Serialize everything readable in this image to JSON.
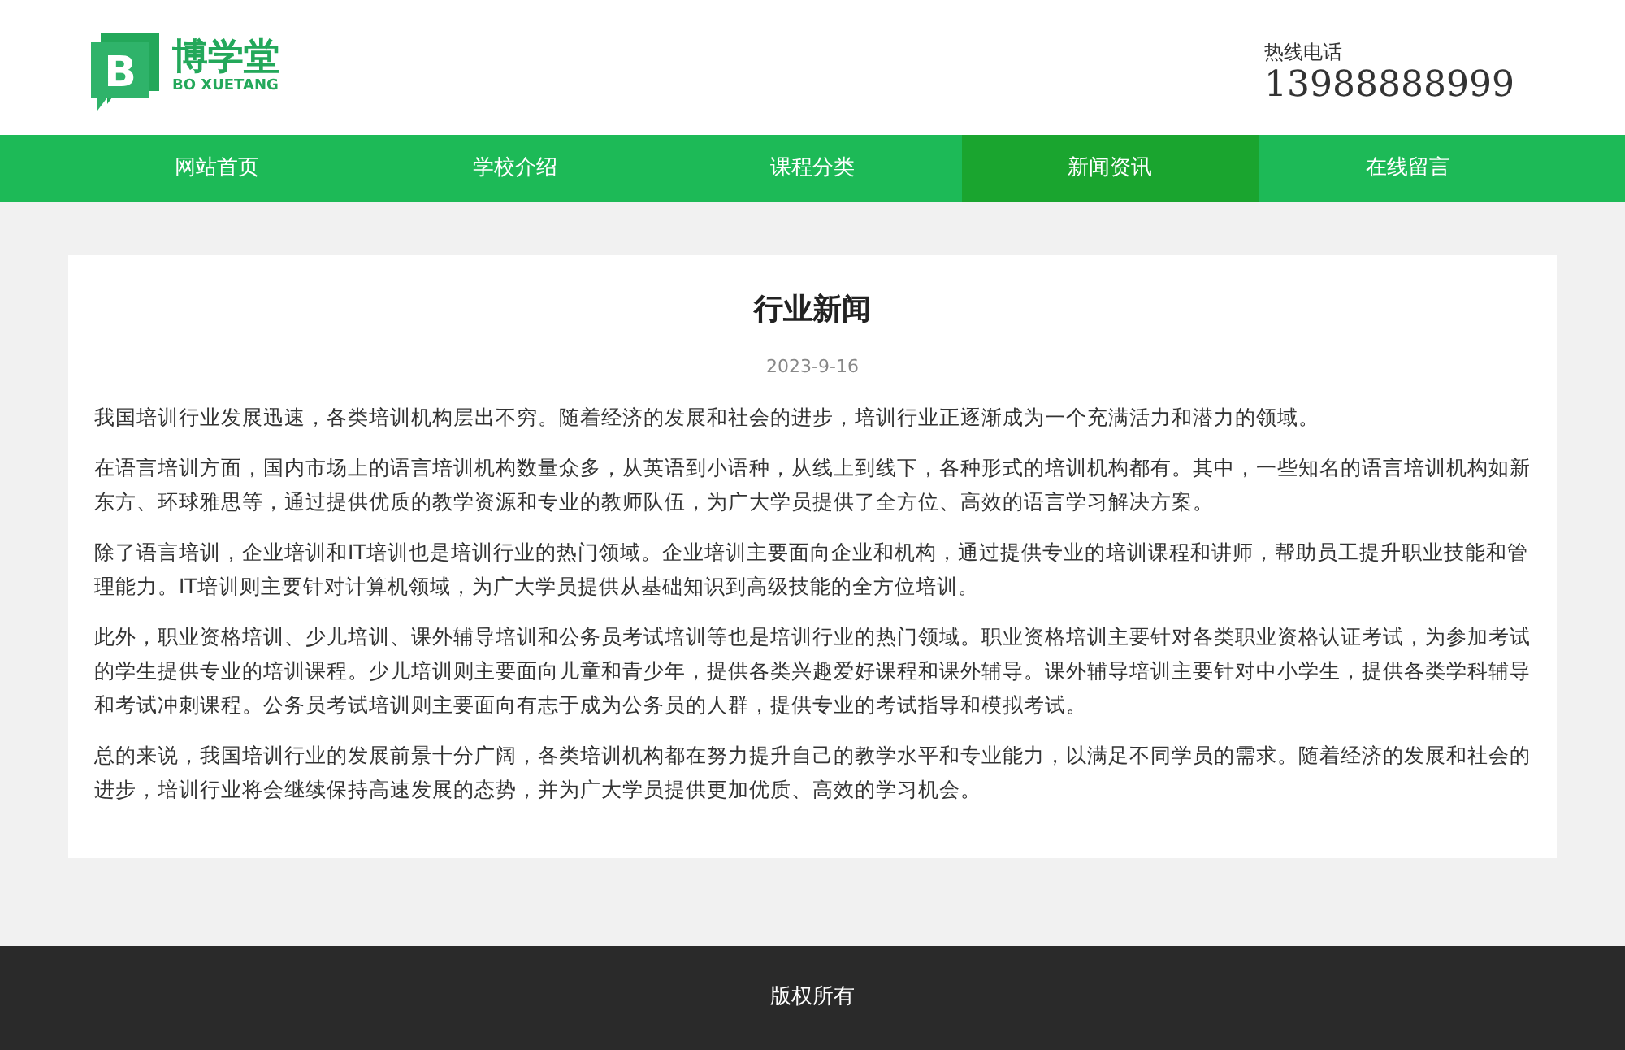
{
  "header": {
    "logo": {
      "letter": "B",
      "name": "博学堂",
      "subtitle": "BO XUETANG"
    },
    "hotline_label": "热线电话",
    "hotline_number": "13988888999"
  },
  "nav": [
    {
      "label": "网站首页",
      "selected": false
    },
    {
      "label": "学校介绍",
      "selected": false
    },
    {
      "label": "课程分类",
      "selected": false
    },
    {
      "label": "新闻资讯",
      "selected": true
    },
    {
      "label": "在线留言",
      "selected": false
    }
  ],
  "article": {
    "title": "行业新闻",
    "date": "2023-9-16",
    "paragraphs": [
      "我国培训行业发展迅速，各类培训机构层出不穷。随着经济的发展和社会的进步，培训行业正逐渐成为一个充满活力和潜力的领域。",
      "在语言培训方面，国内市场上的语言培训机构数量众多，从英语到小语种，从线上到线下，各种形式的培训机构都有。其中，一些知名的语言培训机构如新东方、环球雅思等，通过提供优质的教学资源和专业的教师队伍，为广大学员提供了全方位、高效的语言学习解决方案。",
      "除了语言培训，企业培训和IT培训也是培训行业的热门领域。企业培训主要面向企业和机构，通过提供专业的培训课程和讲师，帮助员工提升职业技能和管理能力。IT培训则主要针对计算机领域，为广大学员提供从基础知识到高级技能的全方位培训。",
      "此外，职业资格培训、少儿培训、课外辅导培训和公务员考试培训等也是培训行业的热门领域。职业资格培训主要针对各类职业资格认证考试，为参加考试的学生提供专业的培训课程。少儿培训则主要面向儿童和青少年，提供各类兴趣爱好课程和课外辅导。课外辅导培训主要针对中小学生，提供各类学科辅导和考试冲刺课程。公务员考试培训则主要面向有志于成为公务员的人群，提供专业的考试指导和模拟考试。",
      "总的来说，我国培训行业的发展前景十分广阔，各类培训机构都在努力提升自己的教学水平和专业能力，以满足不同学员的需求。随着经济的发展和社会的进步，培训行业将会继续保持高速发展的态势，并为广大学员提供更加优质、高效的学习机会。"
    ]
  },
  "footer": {
    "copyright": "版权所有"
  }
}
